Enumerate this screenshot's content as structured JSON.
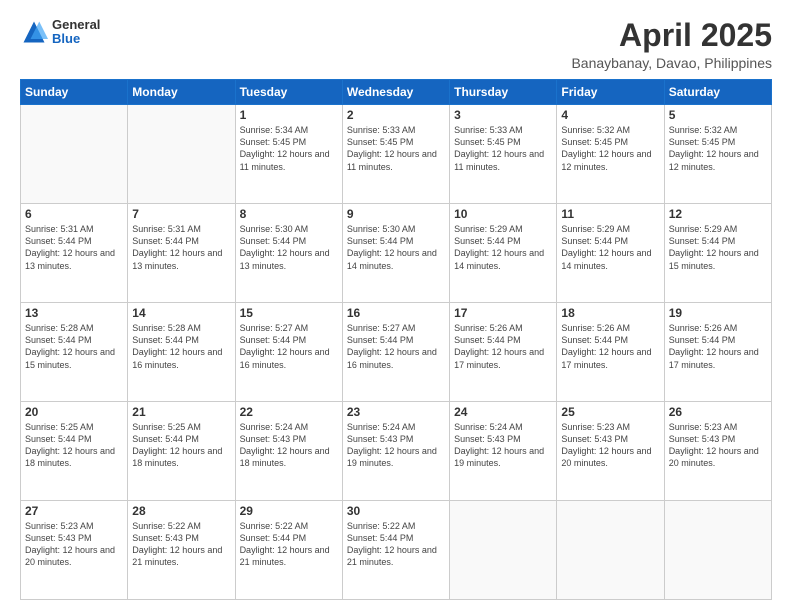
{
  "header": {
    "logo_general": "General",
    "logo_blue": "Blue",
    "title": "April 2025",
    "subtitle": "Banaybanay, Davao, Philippines"
  },
  "weekdays": [
    "Sunday",
    "Monday",
    "Tuesday",
    "Wednesday",
    "Thursday",
    "Friday",
    "Saturday"
  ],
  "weeks": [
    [
      {
        "day": "",
        "info": ""
      },
      {
        "day": "",
        "info": ""
      },
      {
        "day": "1",
        "info": "Sunrise: 5:34 AM\nSunset: 5:45 PM\nDaylight: 12 hours\nand 11 minutes."
      },
      {
        "day": "2",
        "info": "Sunrise: 5:33 AM\nSunset: 5:45 PM\nDaylight: 12 hours\nand 11 minutes."
      },
      {
        "day": "3",
        "info": "Sunrise: 5:33 AM\nSunset: 5:45 PM\nDaylight: 12 hours\nand 11 minutes."
      },
      {
        "day": "4",
        "info": "Sunrise: 5:32 AM\nSunset: 5:45 PM\nDaylight: 12 hours\nand 12 minutes."
      },
      {
        "day": "5",
        "info": "Sunrise: 5:32 AM\nSunset: 5:45 PM\nDaylight: 12 hours\nand 12 minutes."
      }
    ],
    [
      {
        "day": "6",
        "info": "Sunrise: 5:31 AM\nSunset: 5:44 PM\nDaylight: 12 hours\nand 13 minutes."
      },
      {
        "day": "7",
        "info": "Sunrise: 5:31 AM\nSunset: 5:44 PM\nDaylight: 12 hours\nand 13 minutes."
      },
      {
        "day": "8",
        "info": "Sunrise: 5:30 AM\nSunset: 5:44 PM\nDaylight: 12 hours\nand 13 minutes."
      },
      {
        "day": "9",
        "info": "Sunrise: 5:30 AM\nSunset: 5:44 PM\nDaylight: 12 hours\nand 14 minutes."
      },
      {
        "day": "10",
        "info": "Sunrise: 5:29 AM\nSunset: 5:44 PM\nDaylight: 12 hours\nand 14 minutes."
      },
      {
        "day": "11",
        "info": "Sunrise: 5:29 AM\nSunset: 5:44 PM\nDaylight: 12 hours\nand 14 minutes."
      },
      {
        "day": "12",
        "info": "Sunrise: 5:29 AM\nSunset: 5:44 PM\nDaylight: 12 hours\nand 15 minutes."
      }
    ],
    [
      {
        "day": "13",
        "info": "Sunrise: 5:28 AM\nSunset: 5:44 PM\nDaylight: 12 hours\nand 15 minutes."
      },
      {
        "day": "14",
        "info": "Sunrise: 5:28 AM\nSunset: 5:44 PM\nDaylight: 12 hours\nand 16 minutes."
      },
      {
        "day": "15",
        "info": "Sunrise: 5:27 AM\nSunset: 5:44 PM\nDaylight: 12 hours\nand 16 minutes."
      },
      {
        "day": "16",
        "info": "Sunrise: 5:27 AM\nSunset: 5:44 PM\nDaylight: 12 hours\nand 16 minutes."
      },
      {
        "day": "17",
        "info": "Sunrise: 5:26 AM\nSunset: 5:44 PM\nDaylight: 12 hours\nand 17 minutes."
      },
      {
        "day": "18",
        "info": "Sunrise: 5:26 AM\nSunset: 5:44 PM\nDaylight: 12 hours\nand 17 minutes."
      },
      {
        "day": "19",
        "info": "Sunrise: 5:26 AM\nSunset: 5:44 PM\nDaylight: 12 hours\nand 17 minutes."
      }
    ],
    [
      {
        "day": "20",
        "info": "Sunrise: 5:25 AM\nSunset: 5:44 PM\nDaylight: 12 hours\nand 18 minutes."
      },
      {
        "day": "21",
        "info": "Sunrise: 5:25 AM\nSunset: 5:44 PM\nDaylight: 12 hours\nand 18 minutes."
      },
      {
        "day": "22",
        "info": "Sunrise: 5:24 AM\nSunset: 5:43 PM\nDaylight: 12 hours\nand 18 minutes."
      },
      {
        "day": "23",
        "info": "Sunrise: 5:24 AM\nSunset: 5:43 PM\nDaylight: 12 hours\nand 19 minutes."
      },
      {
        "day": "24",
        "info": "Sunrise: 5:24 AM\nSunset: 5:43 PM\nDaylight: 12 hours\nand 19 minutes."
      },
      {
        "day": "25",
        "info": "Sunrise: 5:23 AM\nSunset: 5:43 PM\nDaylight: 12 hours\nand 20 minutes."
      },
      {
        "day": "26",
        "info": "Sunrise: 5:23 AM\nSunset: 5:43 PM\nDaylight: 12 hours\nand 20 minutes."
      }
    ],
    [
      {
        "day": "27",
        "info": "Sunrise: 5:23 AM\nSunset: 5:43 PM\nDaylight: 12 hours\nand 20 minutes."
      },
      {
        "day": "28",
        "info": "Sunrise: 5:22 AM\nSunset: 5:43 PM\nDaylight: 12 hours\nand 21 minutes."
      },
      {
        "day": "29",
        "info": "Sunrise: 5:22 AM\nSunset: 5:44 PM\nDaylight: 12 hours\nand 21 minutes."
      },
      {
        "day": "30",
        "info": "Sunrise: 5:22 AM\nSunset: 5:44 PM\nDaylight: 12 hours\nand 21 minutes."
      },
      {
        "day": "",
        "info": ""
      },
      {
        "day": "",
        "info": ""
      },
      {
        "day": "",
        "info": ""
      }
    ]
  ]
}
